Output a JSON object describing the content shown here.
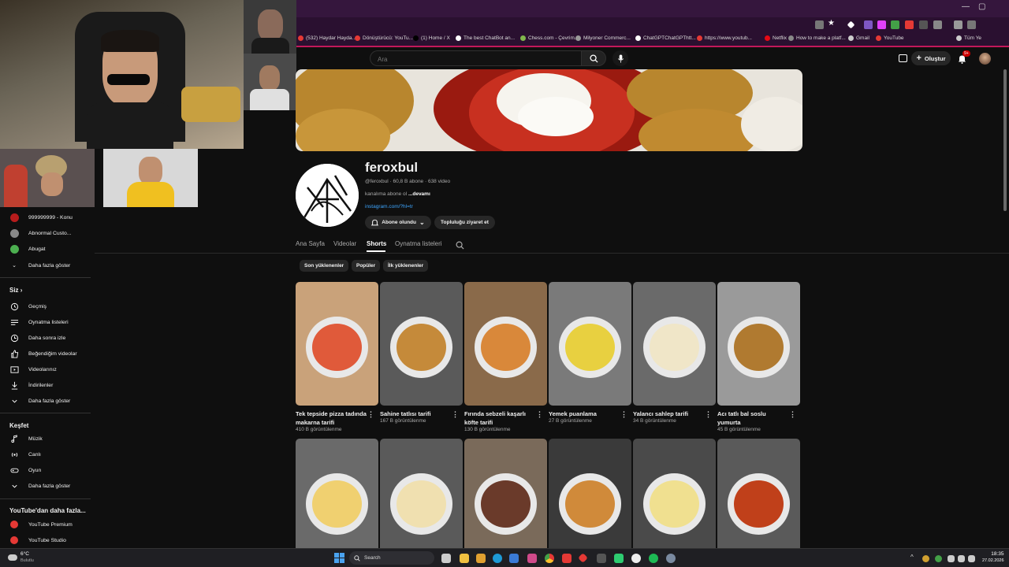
{
  "browser": {
    "bookmarks": [
      {
        "label": "(532) Haydar Hayda...",
        "color": "#e53935"
      },
      {
        "label": "Dönüştürücü: YouTu...",
        "color": "#e53935"
      },
      {
        "label": "(1) Home / X",
        "color": "#000000"
      },
      {
        "label": "The best ChatBot an...",
        "color": "#ffffff"
      },
      {
        "label": "Chess.com - Çevrim...",
        "color": "#81b64c"
      },
      {
        "label": "Milyoner Commerc...",
        "color": "#999999"
      },
      {
        "label": "ChatGPTChatGPThtt...",
        "color": "#ffffff"
      },
      {
        "label": "https://www.youtub...",
        "color": "#e53935"
      },
      {
        "label": "Netflix",
        "color": "#e50914"
      },
      {
        "label": "How to make a platf...",
        "color": "#888888"
      },
      {
        "label": "Gmail",
        "color": "#cccccc"
      },
      {
        "label": "YouTube",
        "color": "#e53935"
      },
      {
        "label": "Tüm Ye",
        "color": "#cccccc"
      }
    ]
  },
  "masthead": {
    "search_placeholder": "Ara",
    "create_label": "Oluştur",
    "notif_badge": "9+"
  },
  "sidebar": {
    "subs": [
      {
        "label": "999999999 - Konu",
        "color": "#b71c1c"
      },
      {
        "label": "Abnormal Custo...",
        "color": "#888888"
      },
      {
        "label": "Abugat",
        "color": "#4caf50"
      }
    ],
    "show_more_1": "Daha fazla göster",
    "siz_title": "Siz",
    "siz": [
      {
        "label": "Geçmiş",
        "icon": "history-icon"
      },
      {
        "label": "Oynatma listeleri",
        "icon": "playlist-icon"
      },
      {
        "label": "Daha sonra izle",
        "icon": "clock-icon"
      },
      {
        "label": "Beğendiğim videolar",
        "icon": "like-icon"
      },
      {
        "label": "Videolarınız",
        "icon": "video-icon"
      },
      {
        "label": "İndirilenler",
        "icon": "download-icon"
      },
      {
        "label": "Daha fazla göster",
        "icon": "chevron-down-icon"
      }
    ],
    "explore_title": "Keşfet",
    "explore": [
      {
        "label": "Müzik",
        "icon": "music-icon"
      },
      {
        "label": "Canlı",
        "icon": "live-icon"
      },
      {
        "label": "Oyun",
        "icon": "gamepad-icon"
      },
      {
        "label": "Daha fazla göster",
        "icon": "chevron-down-icon"
      }
    ],
    "more_title": "YouTube'dan daha fazla...",
    "more": [
      {
        "label": "YouTube Premium",
        "color": "#e53935"
      },
      {
        "label": "YouTube Studio",
        "color": "#e53935"
      }
    ]
  },
  "channel": {
    "name": "feroxbul",
    "meta": "@feroxbul · 60,8 B abone · 638 video",
    "desc_prefix": "kanalıma abone ol ",
    "desc_more": "...devamı",
    "link": "instagram.com/?hl=tr",
    "subscribed_label": "Abone olundu",
    "community_label": "Topluluğu ziyaret et"
  },
  "tabs": [
    "Ana Sayfa",
    "Videolar",
    "Shorts",
    "Oynatma listeleri"
  ],
  "active_tab": "Shorts",
  "chips": [
    "Son yüklenenler",
    "Popüler",
    "İlk yüklenenler"
  ],
  "shorts": [
    {
      "title": "Tek tepside pizza tadında makarna tarifi",
      "views": "410 B görüntülenme",
      "bg": "#c9a27a",
      "accent": "#e05a3a"
    },
    {
      "title": "Sahine tatlısı tarifi",
      "views": "167 B görüntülenme",
      "bg": "#5a5a5a",
      "accent": "#c58a3a"
    },
    {
      "title": "Fırında sebzeli kaşarlı köfte tarifi",
      "views": "130 B görüntülenme",
      "bg": "#8a6a4a",
      "accent": "#d9883a"
    },
    {
      "title": "Yemek puanlama",
      "views": "27 B görüntülenme",
      "bg": "#7a7a7a",
      "accent": "#e8d040"
    },
    {
      "title": "Yalancı sahlep tarifi",
      "views": "34 B görüntülenme",
      "bg": "#6a6a6a",
      "accent": "#f0e6c8"
    },
    {
      "title": "Acı tatlı bal soslu yumurta",
      "views": "45 B görüntülenme",
      "bg": "#9a9a9a",
      "accent": "#b07a30"
    },
    {
      "title": "",
      "views": "",
      "bg": "#6a6a6a",
      "accent": "#f0d070"
    },
    {
      "title": "",
      "views": "",
      "bg": "#5a5a5a",
      "accent": "#f0e0b0"
    },
    {
      "title": "",
      "views": "",
      "bg": "#7a6a5a",
      "accent": "#6a3a2a"
    },
    {
      "title": "",
      "views": "",
      "bg": "#3a3a3a",
      "accent": "#d08a3a"
    },
    {
      "title": "",
      "views": "",
      "bg": "#4a4a4a",
      "accent": "#f0e090"
    },
    {
      "title": "",
      "views": "",
      "bg": "#5a5a5a",
      "accent": "#c0401a"
    }
  ],
  "taskbar": {
    "weather_temp": "6°C",
    "weather_desc": "Bulutlu",
    "search_label": "Search",
    "time": "18:35",
    "date": "27.02.2026"
  }
}
